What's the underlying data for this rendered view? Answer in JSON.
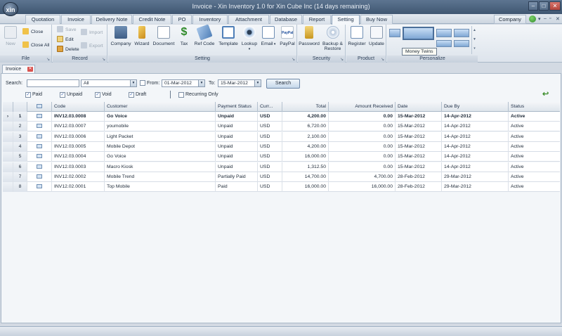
{
  "window": {
    "title": "Invoice - Xin Inventory 1.0 for Xin Cube Inc (14 days remaining)",
    "logo_text": "xin"
  },
  "menu_tabs": [
    {
      "label": "Quotation"
    },
    {
      "label": "Invoice"
    },
    {
      "label": "Delivery Note"
    },
    {
      "label": "Credit Note"
    },
    {
      "label": "PO"
    },
    {
      "label": "Inventory"
    },
    {
      "label": "Attachment"
    },
    {
      "label": "Database"
    },
    {
      "label": "Report"
    },
    {
      "label": "Setting"
    },
    {
      "label": "Buy Now"
    }
  ],
  "active_tab": "Setting",
  "company_label": "Company",
  "ribbon": {
    "file": {
      "label": "File",
      "new": "New",
      "close": "Close",
      "close_all": "Close All"
    },
    "record": {
      "label": "Record",
      "save": "Save",
      "edit": "Edit",
      "delete": "Delete",
      "import": "Import",
      "export": "Export"
    },
    "setting": {
      "label": "Setting",
      "buttons": [
        "Company",
        "Wizard",
        "Document",
        "Tax",
        "Ref Code",
        "Template",
        "Lookup",
        "Email",
        "PayPal"
      ]
    },
    "security": {
      "label": "Security",
      "buttons": [
        "Password",
        "Backup &",
        "Restore"
      ]
    },
    "product": {
      "label": "Product",
      "buttons": [
        "Register",
        "Update"
      ]
    },
    "personalize": {
      "label": "Personalize",
      "tooltip": "Money Twins"
    },
    "paypal_icon_text": "PayPal"
  },
  "doc_tab": {
    "label": "Invoice"
  },
  "filters": {
    "search_label": "Search:",
    "search_value": "",
    "scope_value": "All",
    "from_label": "From:",
    "from_value": "01-Mar-2012",
    "to_label": "To:",
    "to_value": "15-Mar-2012",
    "search_button": "Search",
    "paid": "Paid",
    "unpaid": "Unpaid",
    "void": "Void",
    "draft": "Draft",
    "recurring_only": "Recurring Only"
  },
  "grid": {
    "columns": [
      "Code",
      "Customer",
      "Payment Status",
      "Curr...",
      "Total",
      "Amount Received",
      "Date",
      "Due By",
      "Status"
    ],
    "rows": [
      {
        "n": "1",
        "code": "INV12.03.0008",
        "customer": "Go Voice",
        "payment": "Unpaid",
        "curr": "USD",
        "total": "4,200.00",
        "received": "0.00",
        "date": "15-Mar-2012",
        "due": "14-Apr-2012",
        "status": "Active"
      },
      {
        "n": "2",
        "code": "INV12.03.0007",
        "customer": "youmobile",
        "payment": "Unpaid",
        "curr": "USD",
        "total": "6,720.00",
        "received": "0.00",
        "date": "15-Mar-2012",
        "due": "14-Apr-2012",
        "status": "Active"
      },
      {
        "n": "3",
        "code": "INV12.03.0006",
        "customer": "Light Packet",
        "payment": "Unpaid",
        "curr": "USD",
        "total": "2,100.00",
        "received": "0.00",
        "date": "15-Mar-2012",
        "due": "14-Apr-2012",
        "status": "Active"
      },
      {
        "n": "4",
        "code": "INV12.03.0005",
        "customer": "Mobile Depot",
        "payment": "Unpaid",
        "curr": "USD",
        "total": "4,200.00",
        "received": "0.00",
        "date": "15-Mar-2012",
        "due": "14-Apr-2012",
        "status": "Active"
      },
      {
        "n": "5",
        "code": "INV12.03.0004",
        "customer": "Go Voice",
        "payment": "Unpaid",
        "curr": "USD",
        "total": "16,000.00",
        "received": "0.00",
        "date": "15-Mar-2012",
        "due": "14-Apr-2012",
        "status": "Active"
      },
      {
        "n": "6",
        "code": "INV12.03.0003",
        "customer": "Macro Kiosk",
        "payment": "Unpaid",
        "curr": "USD",
        "total": "1,312.50",
        "received": "0.00",
        "date": "15-Mar-2012",
        "due": "14-Apr-2012",
        "status": "Active"
      },
      {
        "n": "7",
        "code": "INV12.02.0002",
        "customer": "Mobile Trend",
        "payment": "Partially Paid",
        "curr": "USD",
        "total": "14,700.00",
        "received": "4,700.00",
        "date": "28-Feb-2012",
        "due": "29-Mar-2012",
        "status": "Active"
      },
      {
        "n": "8",
        "code": "INV12.02.0001",
        "customer": "Top Mobile",
        "payment": "Paid",
        "curr": "USD",
        "total": "16,000.00",
        "received": "16,000.00",
        "date": "28-Feb-2012",
        "due": "29-Mar-2012",
        "status": "Active"
      }
    ]
  }
}
